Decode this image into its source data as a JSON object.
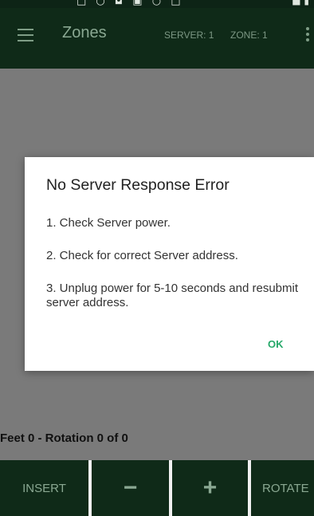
{
  "statusbar": {
    "glyphs": "□ ○ ◘ ▣ ○ □",
    "right": "■ ▮"
  },
  "toolbar": {
    "title": "Zones",
    "server": "SERVER: 1",
    "zone": "ZONE: 1",
    "icons": [
      "menu-icon",
      "more-vert-icon"
    ]
  },
  "dialog": {
    "title": "No Server Response Error",
    "line1": "1. Check Server power.",
    "line2": "2. Check for correct Server address.",
    "line3": "3. Unplug power for 5-10 seconds and resubmit server address.",
    "ok": "OK"
  },
  "status": {
    "text": "Feet 0 - Rotation 0 of 0"
  },
  "buttons": {
    "insert": "INSERT",
    "minus": "−",
    "plus": "+",
    "rotate": "ROTATE"
  },
  "colors": {
    "toolbar_bg": "#0f2a18",
    "accent_text": "#8aa892",
    "ok_green": "#26a869",
    "overlay": "#7a7a7a"
  }
}
